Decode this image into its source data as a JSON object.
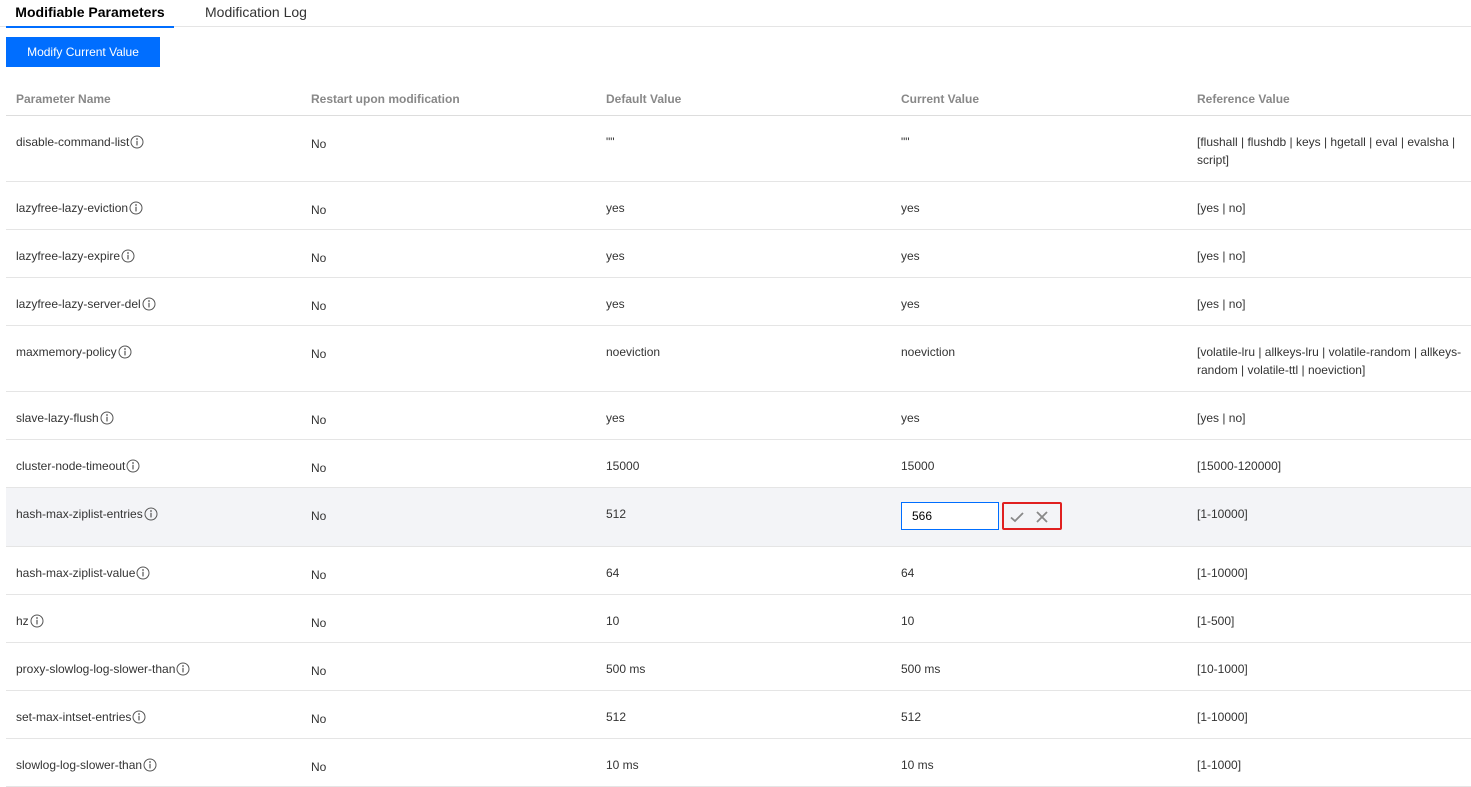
{
  "tabs": [
    {
      "label": "Modifiable Parameters"
    },
    {
      "label": "Modification Log"
    }
  ],
  "actions": {
    "modify_label": "Modify Current Value"
  },
  "table": {
    "headers": [
      "Parameter Name",
      "Restart upon modification",
      "Default Value",
      "Current Value",
      "Reference Value"
    ],
    "rows": [
      {
        "name": "disable-command-list",
        "restart": "No",
        "default": "\"\"",
        "current": "\"\"",
        "reference": "[flushall | flushdb | keys | hgetall | eval | evalsha | script]"
      },
      {
        "name": "lazyfree-lazy-eviction",
        "restart": "No",
        "default": "yes",
        "current": "yes",
        "reference": "[yes | no]"
      },
      {
        "name": "lazyfree-lazy-expire",
        "restart": "No",
        "default": "yes",
        "current": "yes",
        "reference": "[yes | no]"
      },
      {
        "name": "lazyfree-lazy-server-del",
        "restart": "No",
        "default": "yes",
        "current": "yes",
        "reference": "[yes | no]"
      },
      {
        "name": "maxmemory-policy",
        "restart": "No",
        "default": "noeviction",
        "current": "noeviction",
        "reference": "[volatile-lru | allkeys-lru | volatile-random | allkeys-random | volatile-ttl | noeviction]"
      },
      {
        "name": "slave-lazy-flush",
        "restart": "No",
        "default": "yes",
        "current": "yes",
        "reference": "[yes | no]"
      },
      {
        "name": "cluster-node-timeout",
        "restart": "No",
        "default": "15000",
        "current": "15000",
        "reference": "[15000-120000]"
      },
      {
        "name": "hash-max-ziplist-entries",
        "restart": "No",
        "default": "512",
        "current": "566",
        "reference": "[1-10000]"
      },
      {
        "name": "hash-max-ziplist-value",
        "restart": "No",
        "default": "64",
        "current": "64",
        "reference": "[1-10000]"
      },
      {
        "name": "hz",
        "restart": "No",
        "default": "10",
        "current": "10",
        "reference": "[1-500]"
      },
      {
        "name": "proxy-slowlog-log-slower-than",
        "restart": "No",
        "default": "500 ms",
        "current": "500  ms",
        "reference": "[10-1000]"
      },
      {
        "name": "set-max-intset-entries",
        "restart": "No",
        "default": "512",
        "current": "512",
        "reference": "[1-10000]"
      },
      {
        "name": "slowlog-log-slower-than",
        "restart": "No",
        "default": "10 ms",
        "current": "10  ms",
        "reference": "[1-1000]"
      }
    ]
  },
  "icons": {
    "info": "info-icon",
    "confirm": "check-icon",
    "cancel": "close-icon"
  },
  "colors": {
    "primary": "#006eff",
    "highlight": "#e02020",
    "editing_row": "#f3f4f7"
  }
}
